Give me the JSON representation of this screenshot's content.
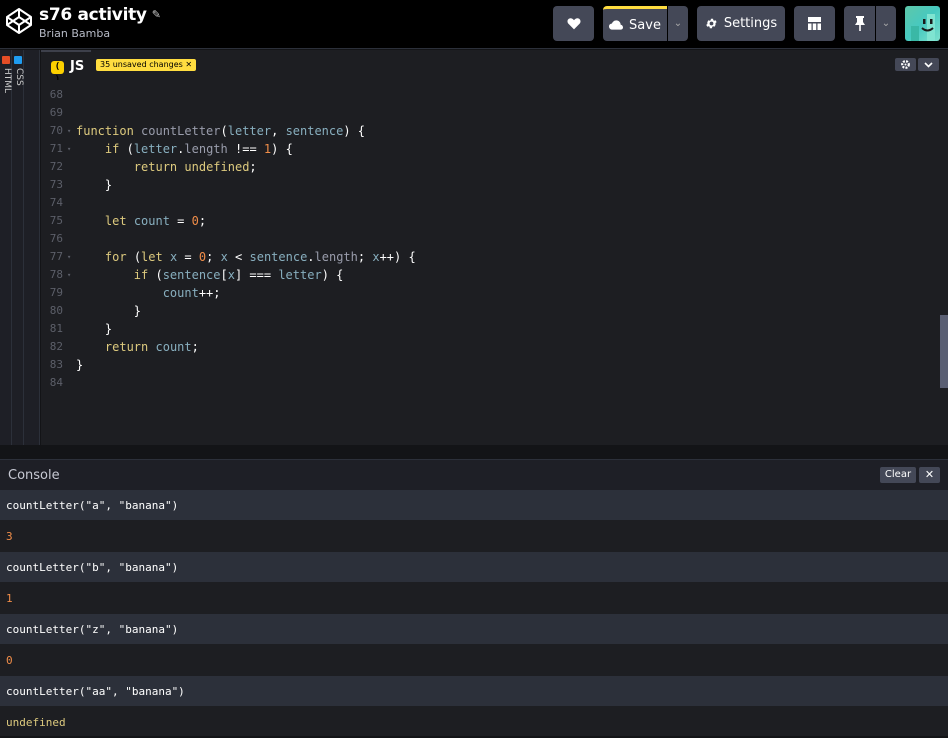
{
  "header": {
    "title": "s76 activity",
    "author": "Brian Bamba",
    "save_label": "Save",
    "settings_label": "Settings"
  },
  "panels": {
    "html_label": "HTML",
    "css_label": "CSS",
    "js_label": "JS",
    "js_icon": "( )",
    "unsaved_badge": "35 unsaved changes ✕"
  },
  "editor": {
    "lines": [
      {
        "n": "68",
        "code": ""
      },
      {
        "n": "69",
        "code": ""
      },
      {
        "n": "70",
        "code": "function countLetter(letter, sentence) {"
      },
      {
        "n": "71",
        "code": "    if (letter.length !== 1) {"
      },
      {
        "n": "72",
        "code": "        return undefined;"
      },
      {
        "n": "73",
        "code": "    }"
      },
      {
        "n": "74",
        "code": ""
      },
      {
        "n": "75",
        "code": "    let count = 0;"
      },
      {
        "n": "76",
        "code": ""
      },
      {
        "n": "77",
        "code": "    for (let x = 0; x < sentence.length; x++) {"
      },
      {
        "n": "78",
        "code": "        if (sentence[x] === letter) {"
      },
      {
        "n": "79",
        "code": "            count++;"
      },
      {
        "n": "80",
        "code": "        }"
      },
      {
        "n": "81",
        "code": "    }"
      },
      {
        "n": "82",
        "code": "    return count;"
      },
      {
        "n": "83",
        "code": "}"
      },
      {
        "n": "84",
        "code": ""
      }
    ]
  },
  "console": {
    "title": "Console",
    "clear_label": "Clear",
    "close_label": "✕",
    "entries": [
      {
        "input": "countLetter(\"a\", \"banana\")",
        "output": "3"
      },
      {
        "input": "countLetter(\"b\", \"banana\")",
        "output": "1"
      },
      {
        "input": "countLetter(\"z\", \"banana\")",
        "output": "0"
      },
      {
        "input": "countLetter(\"aa\", \"banana\")",
        "output": "undefined"
      }
    ]
  },
  "colors": {
    "accent": "#ffdd40",
    "background": "#1d1e22",
    "number": "#f08d49",
    "keyword": "#ddca7e"
  }
}
